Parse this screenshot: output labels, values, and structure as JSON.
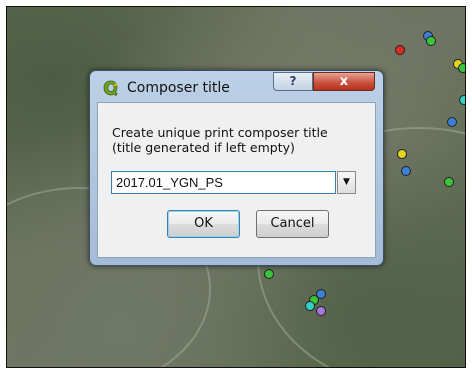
{
  "dialog": {
    "title": "Composer title",
    "help_label": "?",
    "close_label": "x",
    "prompt_line1": "Create unique print composer title",
    "prompt_line2": "(title generated if left empty)",
    "title_value": "2017.01_YGN_PS",
    "ok_label": "OK",
    "cancel_label": "Cancel"
  },
  "colors": {
    "point_red": "#e02a1f",
    "point_blue": "#3d7fd6",
    "point_green": "#3ac43a",
    "point_yellow": "#e2d51e",
    "point_cyan": "#2ed1c4",
    "point_purple": "#a777e0"
  }
}
